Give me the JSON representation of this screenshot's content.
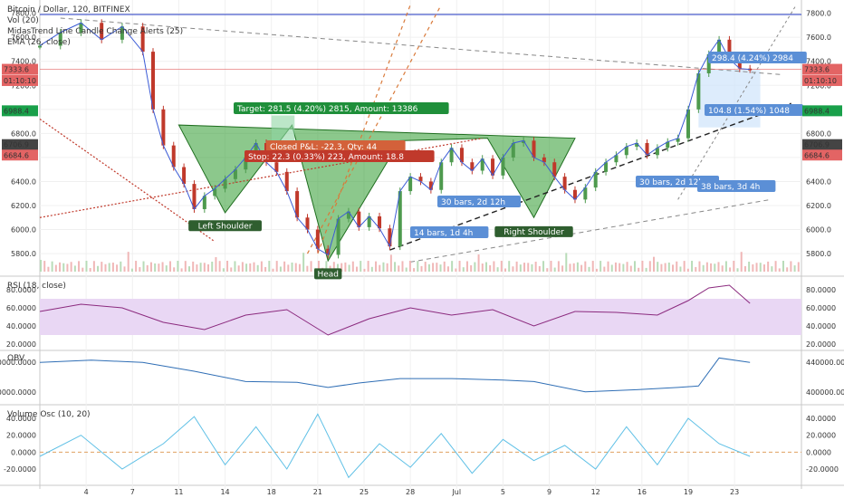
{
  "header": {
    "symbol": "Bitcoin / Dollar, 120, BITFINEX",
    "studies": [
      "Vol (20)",
      "MidasTrend Line Candle Change Alerts (25)",
      "EMA (26, close)"
    ]
  },
  "colors": {
    "up": "#4e9a4e",
    "down": "#c0392b",
    "pattern_fill": "#2e9b2e",
    "target": "#19a04a",
    "stop": "#c0392b",
    "ema": "#3b5bd6",
    "rsi_line": "#8b2a7e",
    "rsi_band": "#e9d7f4",
    "obv_line": "#2f6eb5",
    "vosc_line": "#5fc0e6",
    "measure_box": "#cfe4fb",
    "price_line": "#e36464"
  },
  "chart_data": [
    {
      "type": "line",
      "panel": "price",
      "title": "Bitcoin / Dollar, 120, BITFINEX",
      "y_ticks": [
        5800,
        6000,
        6200,
        6400,
        6600,
        6800,
        7000,
        7200,
        7400,
        7600,
        7800
      ],
      "ylim": [
        5650,
        7850
      ],
      "x_ticks": [
        "4",
        "7",
        "11",
        "14",
        "18",
        "21",
        "25",
        "28",
        "Jul",
        "5",
        "9",
        "12",
        "16",
        "19",
        "23"
      ],
      "xlim": [
        0,
        14.8
      ],
      "series": [
        {
          "name": "price",
          "x": [
            0.0,
            0.4,
            0.8,
            1.2,
            1.6,
            2.0,
            2.2,
            2.4,
            2.6,
            2.8,
            3.0,
            3.2,
            3.4,
            3.6,
            3.8,
            4.0,
            4.2,
            4.4,
            4.6,
            4.8,
            5.0,
            5.2,
            5.4,
            5.6,
            5.8,
            6.0,
            6.2,
            6.4,
            6.6,
            6.8,
            7.0,
            7.2,
            7.4,
            7.6,
            7.8,
            8.0,
            8.2,
            8.4,
            8.6,
            8.8,
            9.0,
            9.2,
            9.4,
            9.6,
            9.8,
            10.0,
            10.2,
            10.4,
            10.6,
            10.8,
            11.0,
            11.2,
            11.4,
            11.6,
            11.8,
            12.0,
            12.2,
            12.4,
            12.6,
            12.8,
            13.0,
            13.2,
            13.4,
            13.6,
            13.8
          ],
          "values": [
            7530,
            7640,
            7720,
            7580,
            7690,
            7480,
            7000,
            6700,
            6520,
            6380,
            6170,
            6280,
            6340,
            6420,
            6500,
            6600,
            6720,
            6560,
            6480,
            6320,
            6100,
            6000,
            5840,
            5790,
            6090,
            6150,
            6020,
            6110,
            6010,
            5860,
            6320,
            6440,
            6400,
            6330,
            6560,
            6680,
            6560,
            6490,
            6590,
            6450,
            6600,
            6720,
            6740,
            6600,
            6560,
            6440,
            6330,
            6250,
            6350,
            6480,
            6560,
            6620,
            6690,
            6720,
            6620,
            6680,
            6730,
            6760,
            7000,
            7300,
            7460,
            7580,
            7420,
            7340,
            7333
          ]
        },
        {
          "name": "EMA (26, close)",
          "values": []
        }
      ],
      "levels": {
        "last_price": "7333.6",
        "ema_value": "6988.4",
        "pane_labels": [
          "7333.6",
          "01:10:10",
          "6988.4",
          "6706.9",
          "6684.6"
        ]
      },
      "pattern": {
        "labels": [
          "Left Shoulder",
          "Head",
          "Right Shoulder"
        ],
        "neckline": [
          6870,
          6760
        ],
        "points": [
          [
            2.7,
            6870
          ],
          [
            3.6,
            6140
          ],
          [
            4.9,
            6870
          ],
          [
            5.6,
            5740
          ],
          [
            7.0,
            6740
          ],
          [
            8.7,
            6760
          ],
          [
            9.6,
            6100
          ],
          [
            10.4,
            6760
          ]
        ]
      },
      "annotations": {
        "target": "Target: 281.5 (4.20%) 2815, Amount: 13386",
        "closed_pl": "Closed P&L: -22.3, Qty: 44",
        "stop": "Stop: 22.3 (0.33%) 223, Amount: 18.8",
        "measure1": "298.4 (4.24%) 2984",
        "measure2": "104.8 (1.54%) 1048",
        "bars1": "30 bars, 2d 12h",
        "bars2": "14 bars, 1d 4h",
        "bars3": "30 bars, 2d 12h",
        "bars4": "38 bars, 3d 4h"
      }
    },
    {
      "type": "line",
      "panel": "rsi",
      "title": "RSI (18, close)",
      "y_ticks": [
        20,
        40,
        60,
        80
      ],
      "ylim": [
        15,
        90
      ],
      "band": [
        30,
        70
      ],
      "series": [
        {
          "name": "RSI (18, close)",
          "x": [
            0,
            0.8,
            1.6,
            2.4,
            3.2,
            4.0,
            4.8,
            5.6,
            6.4,
            7.2,
            8.0,
            8.8,
            9.6,
            10.4,
            11.2,
            12.0,
            12.6,
            13.0,
            13.4,
            13.8
          ],
          "values": [
            56,
            64,
            60,
            44,
            36,
            52,
            58,
            30,
            48,
            60,
            52,
            58,
            40,
            56,
            55,
            52,
            68,
            82,
            85,
            65
          ]
        }
      ]
    },
    {
      "type": "line",
      "panel": "obv",
      "title": "OBV",
      "y_ticks": [
        400000,
        440000
      ],
      "ylim": [
        385000,
        455000
      ],
      "series": [
        {
          "name": "OBV",
          "x": [
            0,
            1,
            2,
            3,
            4,
            5,
            5.6,
            6.2,
            7,
            8,
            9,
            9.6,
            10.6,
            11.6,
            12.4,
            12.8,
            13.2,
            13.8
          ],
          "values": [
            440000,
            443000,
            440000,
            428000,
            414000,
            413000,
            406000,
            412000,
            418000,
            418000,
            416000,
            414000,
            400000,
            403000,
            406000,
            408000,
            446000,
            440000
          ]
        }
      ]
    },
    {
      "type": "line",
      "panel": "vosc",
      "title": "Volume Osc (10, 20)",
      "y_ticks": [
        -20,
        0,
        20,
        40
      ],
      "ylim": [
        -35,
        55
      ],
      "series": [
        {
          "name": "Volume Osc (10, 20)",
          "x": [
            0,
            0.8,
            1.6,
            2.4,
            3.0,
            3.6,
            4.2,
            4.8,
            5.4,
            6.0,
            6.6,
            7.2,
            7.8,
            8.4,
            9.0,
            9.6,
            10.2,
            10.8,
            11.4,
            12.0,
            12.6,
            13.2,
            13.8
          ],
          "values": [
            -5,
            20,
            -20,
            10,
            42,
            -15,
            30,
            -20,
            45,
            -30,
            10,
            -18,
            22,
            -25,
            15,
            -10,
            8,
            -20,
            30,
            -15,
            40,
            10,
            -5
          ]
        }
      ]
    }
  ]
}
